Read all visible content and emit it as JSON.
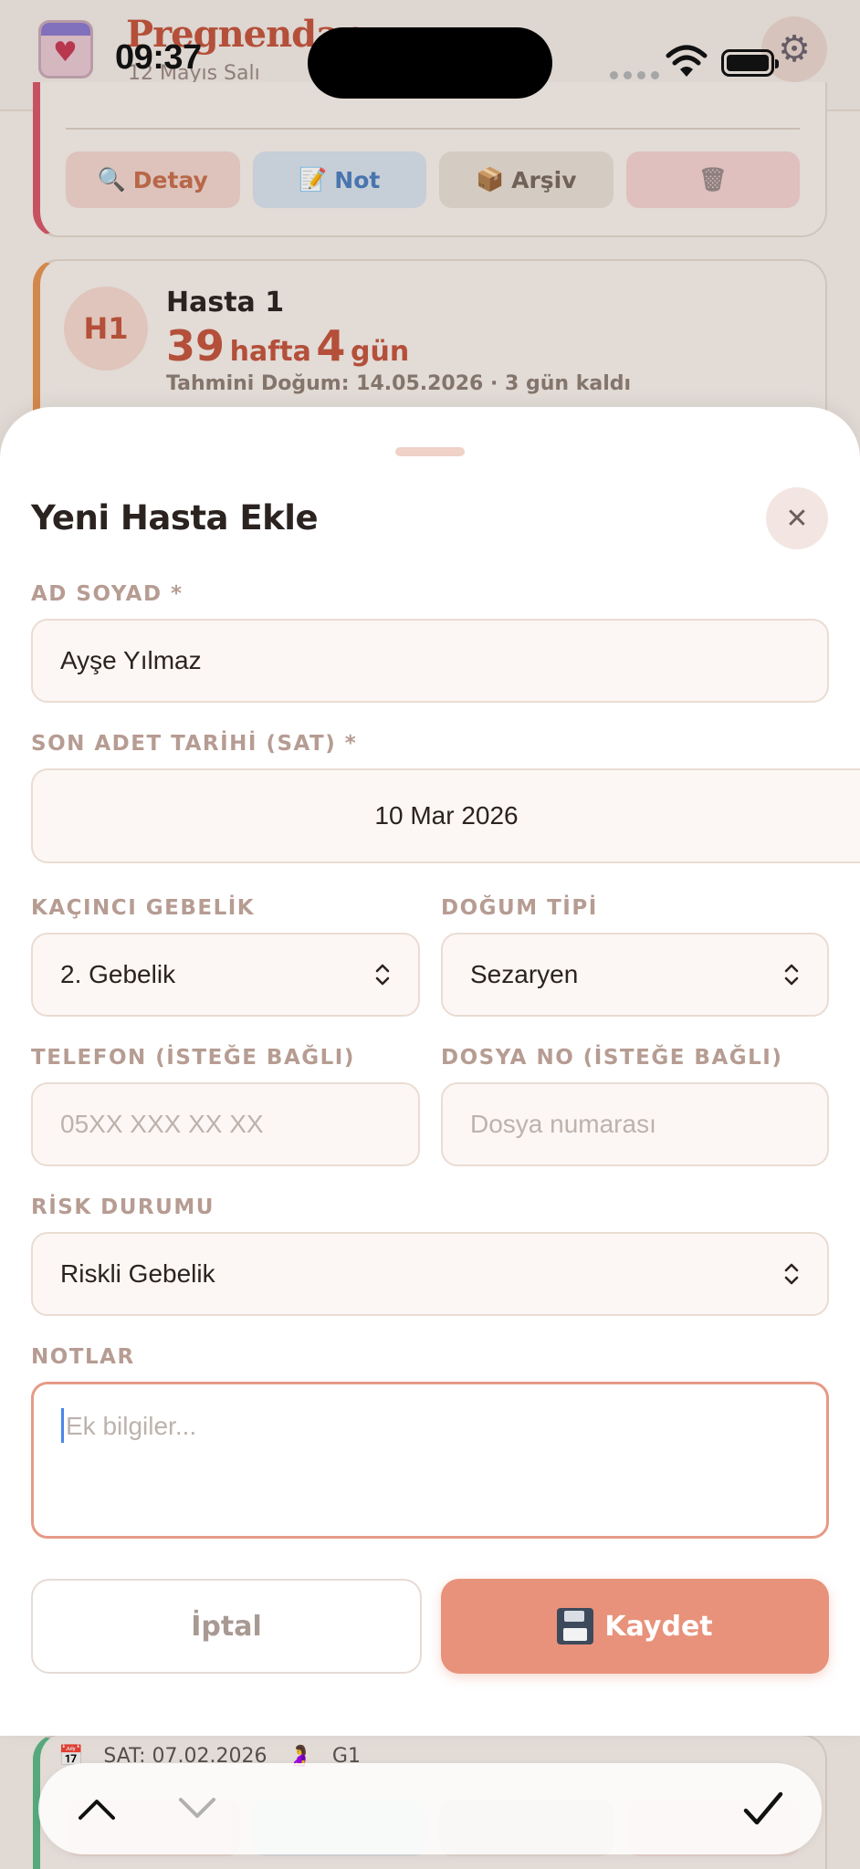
{
  "status_bar": {
    "time": "09:37"
  },
  "app": {
    "title": "Pregnendar",
    "date": "12 Mayıs Salı"
  },
  "cards": {
    "actions": {
      "detail": "Detay",
      "note": "Not",
      "archive": "Arşiv"
    },
    "patient": {
      "initials": "H1",
      "name": "Hasta 1",
      "weeks": "39",
      "weeks_unit": "hafta",
      "days": "4",
      "days_unit": "gün",
      "due": "Tahmini Doğum: 14.05.2026 · 3 gün kaldı"
    },
    "next_patient": {
      "lmp": "SAT: 07.02.2026",
      "gravida": "G1"
    }
  },
  "sheet": {
    "title": "Yeni Hasta Ekle",
    "fields": {
      "name": {
        "label": "AD SOYAD *",
        "value": "Ayşe Yılmaz"
      },
      "lmp": {
        "label": "SON ADET TARİHİ (SAT) *",
        "value": "10 Mar 2026"
      },
      "pregnancy_no": {
        "label": "KAÇINCI GEBELİK",
        "value": "2. Gebelik"
      },
      "delivery_type": {
        "label": "DOĞUM TİPİ",
        "value": "Sezaryen"
      },
      "phone": {
        "label": "TELEFON (İSTEĞE BAĞLI)",
        "placeholder": "05XX XXX XX XX"
      },
      "file_no": {
        "label": "DOSYA NO (İSTEĞE BAĞLI)",
        "placeholder": "Dosya numarası"
      },
      "risk": {
        "label": "RİSK DURUMU",
        "value": "Riskli Gebelik"
      },
      "notes": {
        "label": "NOTLAR",
        "placeholder": "Ek bilgiler..."
      }
    },
    "cancel_label": "İptal",
    "save_label": "Kaydet"
  },
  "colors": {
    "accent": "#e8927b",
    "brand": "#c4553f",
    "label": "#b69c92"
  }
}
